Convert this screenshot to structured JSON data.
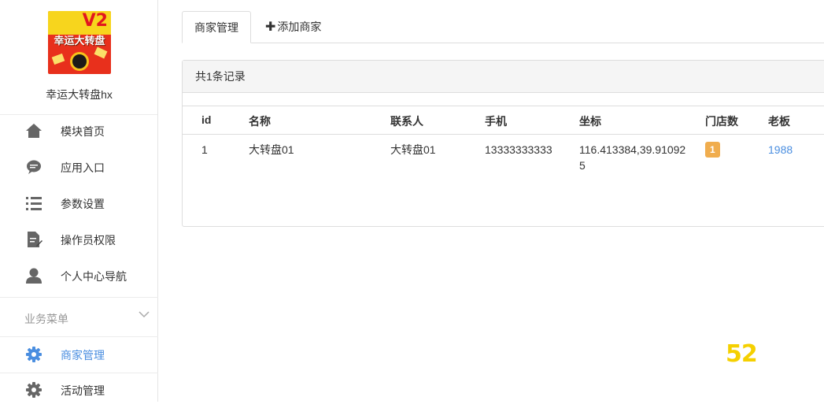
{
  "app": {
    "name": "幸运大转盘hx",
    "logo_text": "幸运大转盘",
    "logo_version": "V2"
  },
  "sidebar": {
    "items": [
      {
        "label": "模块首页",
        "icon": "home-icon"
      },
      {
        "label": "应用入口",
        "icon": "chat-bubble-icon"
      },
      {
        "label": "参数设置",
        "icon": "list-icon"
      },
      {
        "label": "操作员权限",
        "icon": "document-edit-icon"
      },
      {
        "label": "个人中心导航",
        "icon": "user-icon"
      }
    ],
    "group": {
      "label": "业务菜单",
      "icon": "chevron-down-icon"
    },
    "group_items": [
      {
        "label": "商家管理",
        "icon": "gear-icon",
        "active": true
      },
      {
        "label": "活动管理",
        "icon": "gear-icon",
        "active": false
      }
    ]
  },
  "tabs": [
    {
      "label": "商家管理",
      "active": true
    },
    {
      "label": "添加商家",
      "prefix": "✚"
    }
  ],
  "panel": {
    "header": "共1条记录",
    "columns": [
      "id",
      "名称",
      "联系人",
      "手机",
      "坐标",
      "门店数",
      "老板"
    ],
    "rows": [
      {
        "id": "1",
        "name": "大转盘01",
        "contact": "大转盘01",
        "phone": "13333333333",
        "coord_line1": "116.413384,39.91092",
        "coord_line2": "5",
        "stores": "1",
        "boss": "1988"
      }
    ]
  },
  "watermark": "52",
  "colors": {
    "accent": "#4a8ee0",
    "badge": "#f0ad4e",
    "icon": "#666666"
  }
}
